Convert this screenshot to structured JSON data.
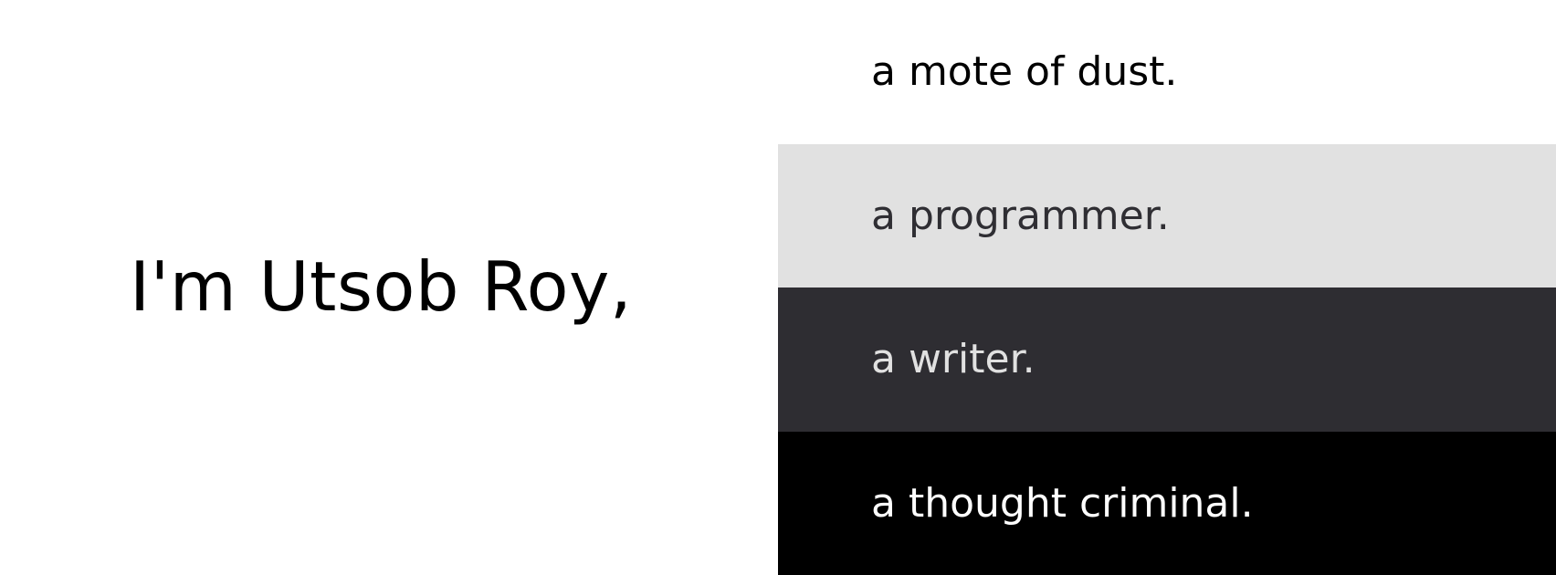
{
  "intro": {
    "text": "I'm Utsob Roy,"
  },
  "roles": [
    {
      "text": "a mote of dust.",
      "bg": "#ffffff",
      "fg": "#000000"
    },
    {
      "text": "a programmer.",
      "bg": "#e1e1e1",
      "fg": "#2f2e33"
    },
    {
      "text": "a writer.",
      "bg": "#2e2d32",
      "fg": "#e1e1e1"
    },
    {
      "text": "a thought criminal.",
      "bg": "#000000",
      "fg": "#ffffff"
    }
  ]
}
